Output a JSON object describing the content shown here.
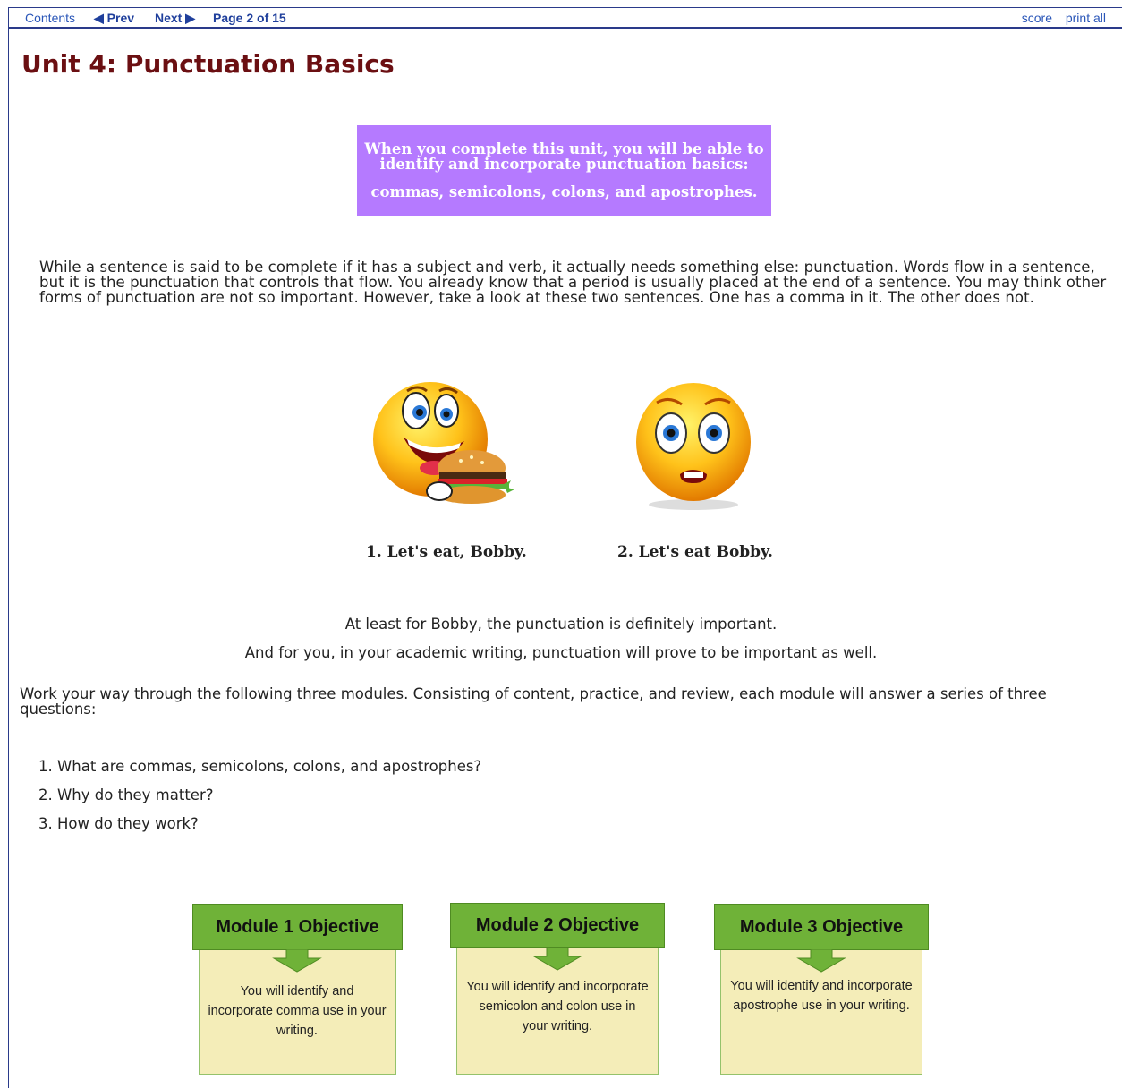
{
  "nav": {
    "contents": "Contents",
    "prev": "◀ Prev",
    "next": "Next ▶",
    "page": "Page 2 of 15",
    "score": "score",
    "print_all": "print all"
  },
  "title": "Unit 4: Punctuation Basics",
  "objective": {
    "line1": "When you complete this unit, you will be able to identify and incorporate punctuation basics:",
    "line2": "commas, semicolons, colons, and apostrophes."
  },
  "intro": "While a sentence is said to be complete if it has a subject and verb, it actually needs something else: punctuation. Words flow in a sentence, but it is the punctuation that controls that flow. You already know that a period is usually placed at the end of a sentence. You may think other forms of punctuation are not so important. However, take a look at these two sentences. One has a comma in it. The other does not.",
  "examples": [
    {
      "caption": "1. Let's eat, Bobby.",
      "image": "happy-eating-burger-emoji"
    },
    {
      "caption": "2. Let's eat Bobby.",
      "image": "scared-emoji"
    }
  ],
  "remark1": "At least for Bobby, the punctuation is definitely important.",
  "remark2": "And for you, in your academic writing, punctuation will prove to be important as well.",
  "modules_intro": "Work your way through the following three modules. Consisting of content, practice, and review, each module will answer a series of three questions:",
  "questions": [
    "1. What are commas, semicolons, colons, and apostrophes?",
    "2. Why do they matter?",
    "3. How do they work?"
  ],
  "modules": [
    {
      "title": "Module 1 Objective",
      "text": "You will identify and incorporate comma use in your writing."
    },
    {
      "title": "Module 2 Objective",
      "text": "You will identify and incorporate semicolon and colon use in your writing."
    },
    {
      "title": "Module 3 Objective",
      "text": "You will identify and incorporate apostrophe use in your writing."
    }
  ],
  "colors": {
    "nav_link": "#1f3f9c",
    "title": "#6b0f12",
    "objective_bg": "#b57aff",
    "module_head": "#6fb238",
    "module_body": "#f4edb8"
  }
}
